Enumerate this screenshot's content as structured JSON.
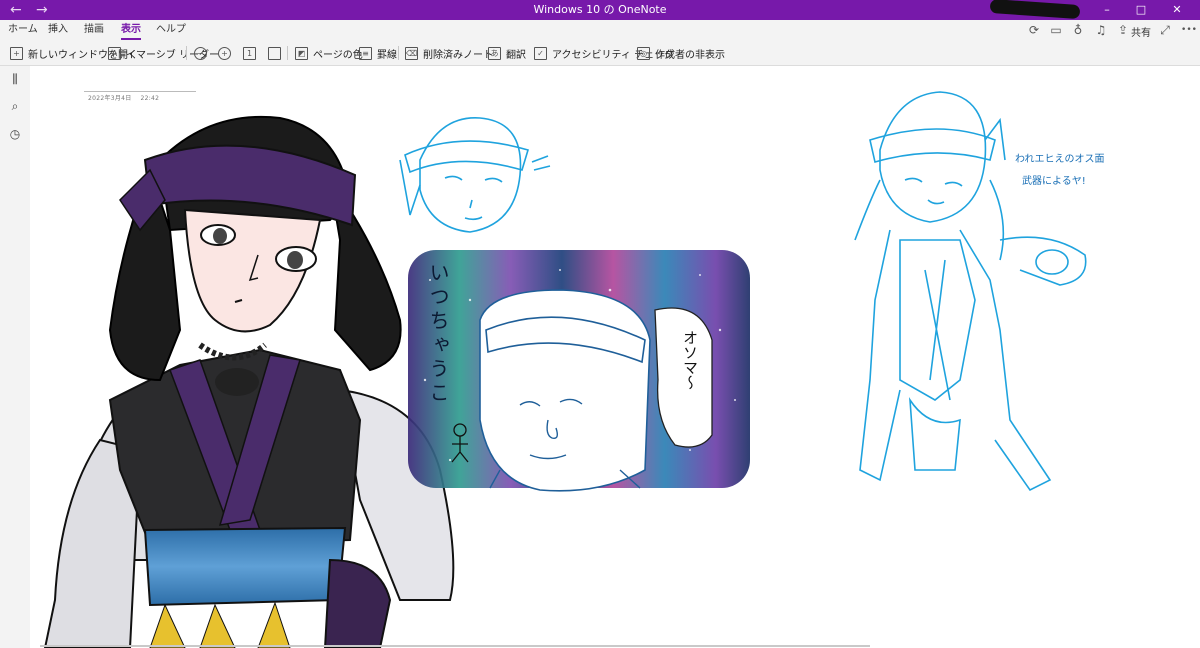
{
  "titlebar": {
    "title": "Windows 10 の OneNote",
    "back_glyph": "←",
    "forward_glyph": "→",
    "minimize_glyph": "–",
    "maximize_glyph": "□",
    "close_glyph": "✕",
    "accent": "#7719aa"
  },
  "tabs": [
    {
      "label": "ホーム"
    },
    {
      "label": "挿入"
    },
    {
      "label": "描画"
    },
    {
      "label": "表示",
      "active": true
    },
    {
      "label": "ヘルプ"
    }
  ],
  "right_actions": {
    "sync_icon": "sync-icon",
    "notebook_icon": "notebook-icon",
    "lightbulb_icon": "lightbulb-icon",
    "bell_icon": "bell-icon",
    "share_label": "共有",
    "expand_icon": "expand-icon",
    "more_label": "•••"
  },
  "toolbar": {
    "new_window": "新しいウィンドウを開く",
    "immersive_reader": "イマーシブ リーダー",
    "page_color": "ページの色",
    "rule_lines": "罫線",
    "deleted_notes": "削除済みノート",
    "translate": "翻訳",
    "accessibility": "アクセシビリティ チェック",
    "hide_authors": "作成者の非表示"
  },
  "rail": {
    "notebooks_icon": "notebooks-icon",
    "search_icon": "search-icon",
    "recent_icon": "recent-icon"
  },
  "page": {
    "date": "2022年3月4日",
    "time": "22:42"
  },
  "drawing": {
    "speech_bubble_text": "オソマ〜",
    "vertical_text": "いつちゃうこ",
    "sketch_caption_line1": "われエヒえのオス面",
    "sketch_caption_line2": "武器によるヤ!",
    "colors": {
      "hair": "#1b1b1b",
      "headband": "#4a2c6b",
      "sash": "#3d7fb8",
      "sketch": "#1fa3de",
      "sketch_dark": "#1f5f99"
    }
  }
}
